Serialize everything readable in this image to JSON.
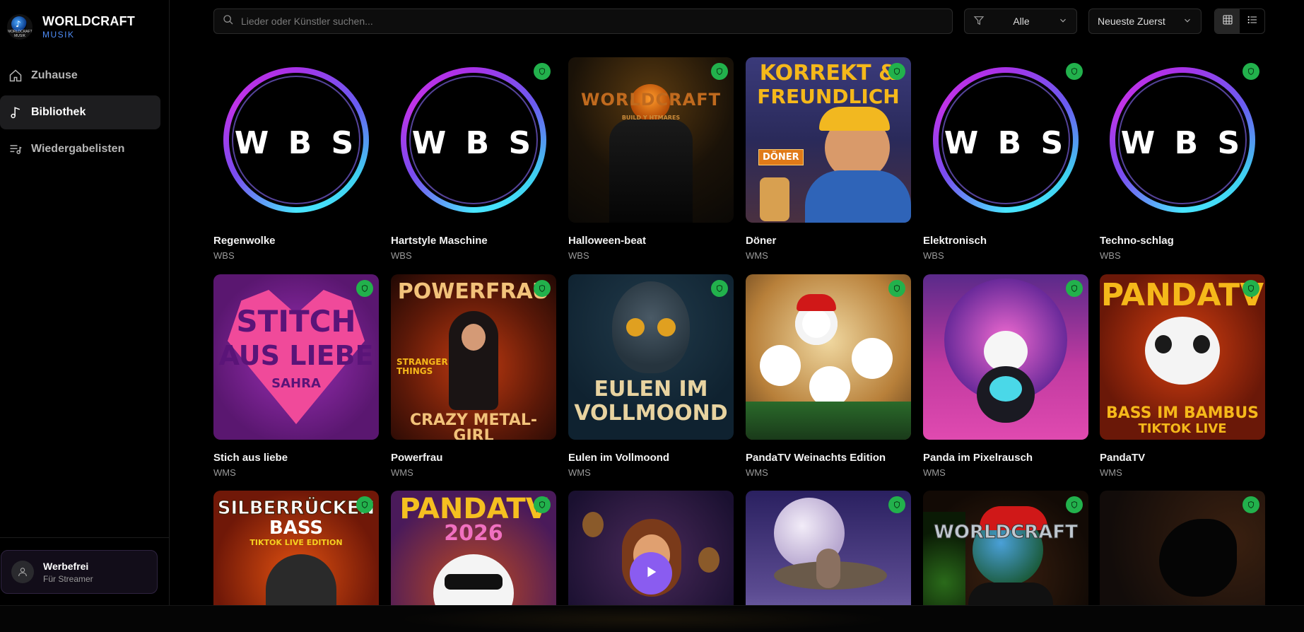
{
  "brand": {
    "logo_caption": "WORLDCRAFT MUSIK",
    "title": "WORLDCRAFT",
    "subtitle": "MUSIK"
  },
  "nav": {
    "items": [
      {
        "label": "Zuhause",
        "icon": "home-icon",
        "active": false
      },
      {
        "label": "Bibliothek",
        "icon": "music-note-icon",
        "active": true
      },
      {
        "label": "Wiedergabelisten",
        "icon": "playlist-icon",
        "active": false
      }
    ]
  },
  "plan": {
    "title": "Werbefrei",
    "subtitle": "Für Streamer"
  },
  "search": {
    "placeholder": "Lieder oder Künstler suchen..."
  },
  "filter": {
    "value": "Alle"
  },
  "sort": {
    "value": "Neueste Zuerst"
  },
  "view": {
    "active": "grid"
  },
  "colors": {
    "accent": "#8a5cf0",
    "badge": "#22b14c",
    "brand_sub": "#4f8df7"
  },
  "tracks": [
    {
      "title": "Regenwolke",
      "artist": "WBS",
      "cover_text": "W B S",
      "badge": false
    },
    {
      "title": "Hartstyle Maschine",
      "artist": "WBS",
      "cover_text": "W B S",
      "badge": true
    },
    {
      "title": "Halloween-beat",
      "artist": "WBS",
      "cover_text": "WORLDCRAFT",
      "cover_sub": "BUILD Y       HTMARES",
      "badge": true
    },
    {
      "title": "Döner",
      "artist": "WMS",
      "cover_text": "KORREKT &",
      "cover_text2": "FREUNDLICH",
      "cover_sub": "DÖNER",
      "badge": true
    },
    {
      "title": "Elektronisch",
      "artist": "WBS",
      "cover_text": "W B S",
      "badge": true
    },
    {
      "title": "Techno-schlag",
      "artist": "WBS",
      "cover_text": "W B S",
      "badge": true
    },
    {
      "title": "Stich aus liebe",
      "artist": "WMS",
      "cover_text": "STITCH",
      "cover_text2": "AUS LIEBE",
      "cover_sub": "SAHRA",
      "badge": true
    },
    {
      "title": "Powerfrau",
      "artist": "WMS",
      "cover_text": "POWERFRAU",
      "cover_text2": "CRAZY METAL-GIRL",
      "cover_sub": "STRANGER THINGS",
      "badge": true
    },
    {
      "title": "Eulen im Vollmoond",
      "artist": "WMS",
      "cover_text": "EULEN IM",
      "cover_text2": "VOLLMOOND",
      "badge": true
    },
    {
      "title": "PandaTV Weinachts Edition",
      "artist": "WMS",
      "badge": true
    },
    {
      "title": "Panda im Pixelrausch",
      "artist": "WMS",
      "badge": true
    },
    {
      "title": "PandaTV",
      "artist": "WMS",
      "cover_text": "PANDATV",
      "cover_text2": "BASS IM BAMBUS",
      "cover_sub": "TIKTOK LIVE",
      "badge": true
    },
    {
      "title": "",
      "artist": "",
      "cover_text": "SILBERRÜCKEN",
      "cover_text2": "BASS",
      "cover_sub": "TIKTOK LIVE EDITION",
      "badge": true
    },
    {
      "title": "",
      "artist": "",
      "cover_text": "PANDATV",
      "cover_text2": "2026",
      "badge": true
    },
    {
      "title": "",
      "artist": "",
      "badge": false,
      "play": true
    },
    {
      "title": "",
      "artist": "",
      "badge": true
    },
    {
      "title": "",
      "artist": "",
      "cover_text": "WORLDCRAFT",
      "badge": true
    },
    {
      "title": "",
      "artist": "",
      "badge": true
    }
  ]
}
